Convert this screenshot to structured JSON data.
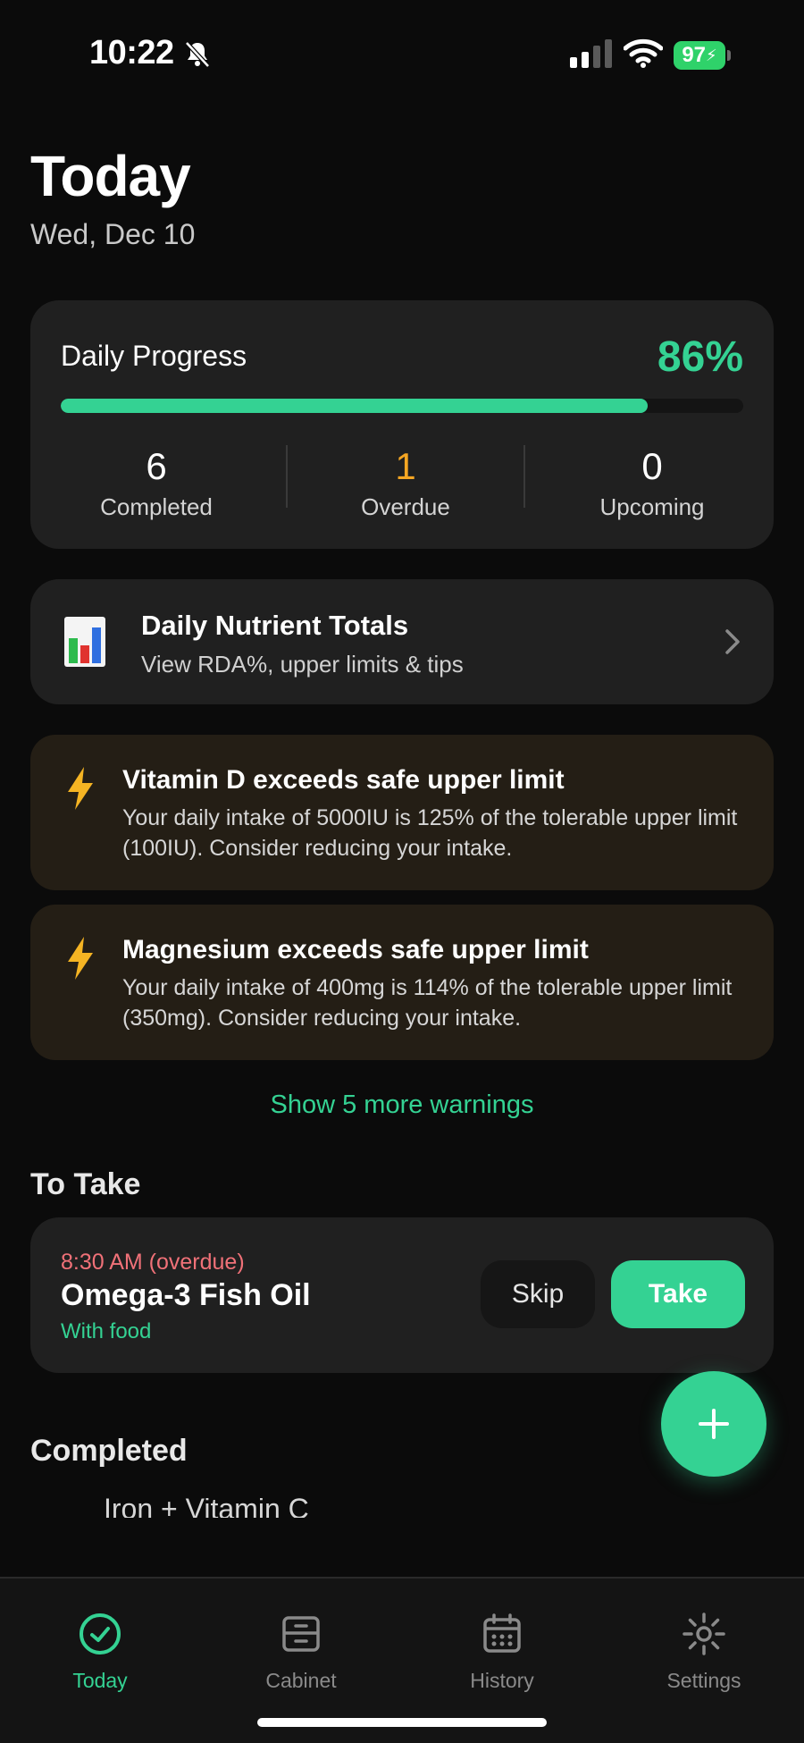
{
  "status_bar": {
    "time": "10:22",
    "battery": "97"
  },
  "header": {
    "title": "Today",
    "date": "Wed, Dec 10"
  },
  "progress": {
    "title": "Daily Progress",
    "percent_label": "86%",
    "percent_value": 0.86,
    "stats": [
      {
        "value": "6",
        "label": "Completed",
        "color": "#ffffff"
      },
      {
        "value": "1",
        "label": "Overdue",
        "color": "#f5a623"
      },
      {
        "value": "0",
        "label": "Upcoming",
        "color": "#ffffff"
      }
    ]
  },
  "nutrients": {
    "title": "Daily Nutrient Totals",
    "subtitle": "View RDA%, upper limits & tips"
  },
  "warnings": [
    {
      "title": "Vitamin D exceeds safe upper limit",
      "body": "Your daily intake of 5000IU is 125% of the tolerable upper limit (100IU). Consider reducing your intake."
    },
    {
      "title": "Magnesium exceeds safe upper limit",
      "body": "Your daily intake of 400mg is 114% of the tolerable upper limit (350mg). Consider reducing your intake."
    }
  ],
  "more_warnings_label": "Show 5 more warnings",
  "to_take": {
    "heading": "To Take",
    "items": [
      {
        "time": "8:30 AM (overdue)",
        "name": "Omega-3 Fish Oil",
        "note": "With food",
        "skip_label": "Skip",
        "take_label": "Take"
      }
    ]
  },
  "completed": {
    "heading": "Completed",
    "first_item_partial": "Iron + Vitamin C"
  },
  "tabs": [
    {
      "label": "Today",
      "icon": "check-circle-icon",
      "active": true
    },
    {
      "label": "Cabinet",
      "icon": "cabinet-icon",
      "active": false
    },
    {
      "label": "History",
      "icon": "calendar-icon",
      "active": false
    },
    {
      "label": "Settings",
      "icon": "gear-icon",
      "active": false
    }
  ],
  "colors": {
    "accent": "#34d293",
    "overdue": "#f07178",
    "warning_bg": "#241e15",
    "card_bg": "#202020"
  }
}
